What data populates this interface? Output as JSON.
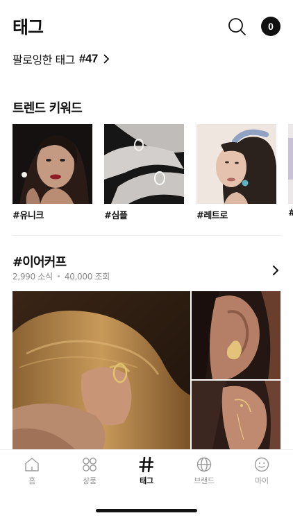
{
  "header": {
    "title": "태그",
    "cart_count": "0"
  },
  "follow": {
    "label": "팔로잉한 태그",
    "count": "#47"
  },
  "trend": {
    "title": "트렌드 키워드",
    "items": [
      {
        "label": "#유니크"
      },
      {
        "label": "#심플"
      },
      {
        "label": "#레트로"
      },
      {
        "label": "#"
      }
    ]
  },
  "featured_tag": {
    "name": "#이어커프",
    "posts": "2,990 소식",
    "views": "40,000 조회"
  },
  "tabbar": {
    "items": [
      {
        "label": "홈",
        "icon": "home-icon"
      },
      {
        "label": "상품",
        "icon": "grid-circles-icon"
      },
      {
        "label": "태그",
        "icon": "hash-icon"
      },
      {
        "label": "브랜드",
        "icon": "globe-icon"
      },
      {
        "label": "마이",
        "icon": "smile-icon"
      }
    ],
    "active": "태그"
  }
}
